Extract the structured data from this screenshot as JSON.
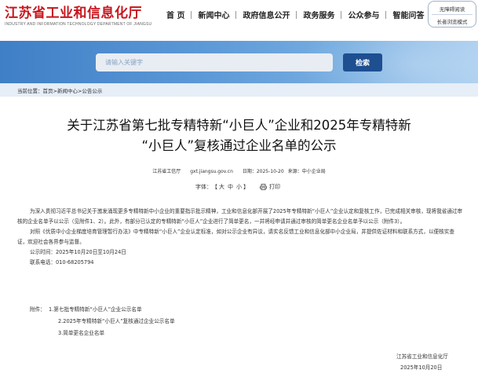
{
  "header": {
    "logo_cn": "江苏省工业和信息化厅",
    "logo_en": "INDUSTRY AND INFORMATION TECHNOLOGY DEPARTMENT OF JIANGSU",
    "nav": [
      "首 页",
      "新闻中心",
      "政府信息公开",
      "政务服务",
      "公众参与",
      "智能问答"
    ],
    "accessibility_label": "无障碍阅读",
    "elder_mode_label": "长者浏览模式"
  },
  "search": {
    "placeholder": "请输入关键字",
    "button_label": "检索"
  },
  "breadcrumb": {
    "prefix": "当前位置：",
    "items": [
      "首页",
      "新闻中心",
      "公告公示"
    ],
    "separator": ">"
  },
  "article": {
    "title_line1": "关于江苏省第七批专精特新“小巨人”企业和2025年专精特新",
    "title_line2": "“小巨人”复核通过企业名单的公示",
    "source": "江苏省工信厅",
    "domain": "gxt.jiangsu.gov.cn",
    "date": "日期：2025-10-20",
    "origin": "来源：中小企业局",
    "font_label": "字体：",
    "font_sizes": [
      "大",
      "中",
      "小"
    ],
    "font_open": "【",
    "font_close": "】",
    "print_label": "打印",
    "paragraph1": "为深入贯彻习近平总书记关于激发涌现更多专精特新中小企业的重要指示批示精神，工业和信息化部开展了2025年专精特新“小巨人”企业认定和复核工作，已完成相关审核，现将我省通过审核的企业名单予以公示（见附件1、2）。此外，有部分已认定的专精特新“小巨人”企业进行了简单更名，一并将经申请并通过审核的简单更名企业名单予以公示（附件3）。",
    "paragraph2": "对照《优质中小企业梯度培育管理暂行办法》中专精特新“小巨人”企业认定标准，如对公示企业有异议，请实名反馈工业和信息化部中小企业局，并提供佐证材料和联系方式，以便核实查证，欢迎社会各界参与监督。",
    "period": "公示时间：2025年10月20日至10月24日",
    "phone": "联系电话：010-68205794",
    "attachments_label": "附件：",
    "attachments": [
      "1.第七批专精特新“小巨人”企业公示名单",
      "2.2025年专精特新“小巨人”复核通过企业公示名单",
      "3.简单更名企业名单"
    ],
    "sign_org": "江苏省工业和信息化厅",
    "sign_date": "2025年10月20日"
  },
  "colors": {
    "brand_red": "#c8161d",
    "search_button": "#1d4f91",
    "banner": "#4a89cd",
    "breadcrumb_bg": "#e6eef8"
  }
}
